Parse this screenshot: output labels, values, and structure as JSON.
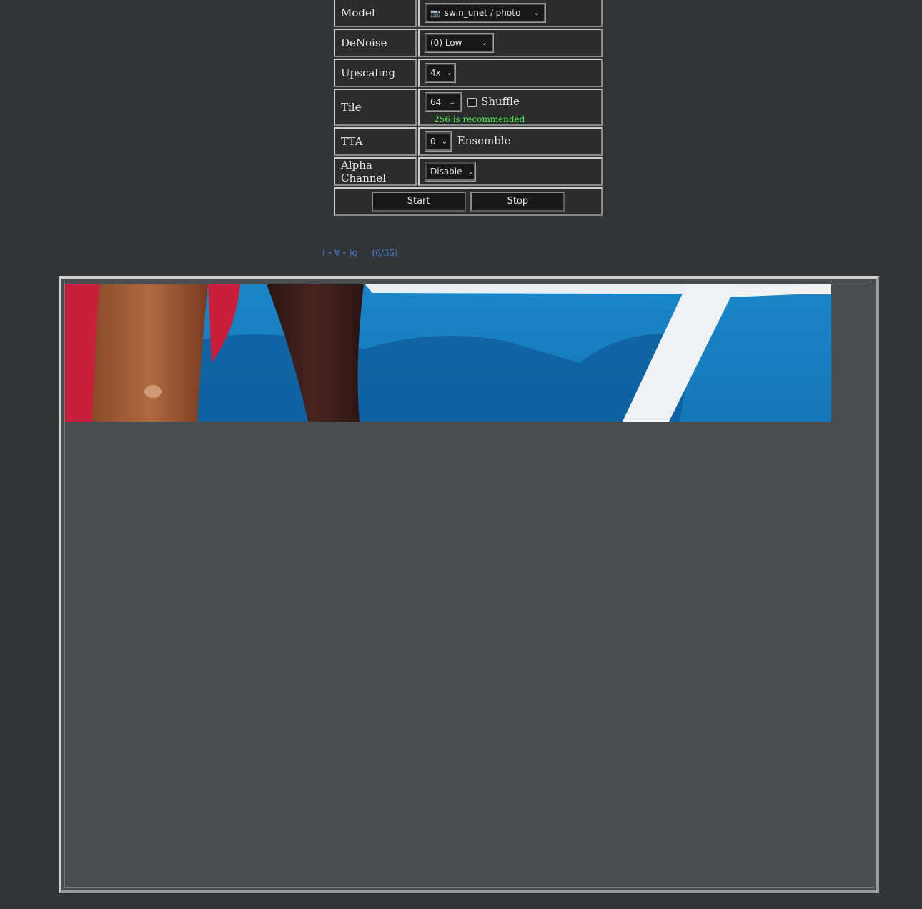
{
  "settings": {
    "model": {
      "label": "Model",
      "value": "swin_unet / photo",
      "icon": "camera-icon"
    },
    "denoise": {
      "label": "DeNoise",
      "value": "(0) Low"
    },
    "upscaling": {
      "label": "Upscaling",
      "value": "4x"
    },
    "tile": {
      "label": "Tile",
      "value": "64",
      "shuffle_label": "Shuffle",
      "shuffle_checked": false,
      "hint": "256 is recommended",
      "hint_color": "#47ef47"
    },
    "tta": {
      "label": "TTA",
      "value": "0",
      "ensemble_label": "Ensemble"
    },
    "alpha": {
      "label": "Alpha Channel",
      "value": "Disable"
    },
    "buttons": {
      "start": "Start",
      "stop": "Stop"
    }
  },
  "status": {
    "face": "(・∀・)φ",
    "progress": "(6/35)",
    "color": "#4a7fe0"
  },
  "viewer": {
    "image_description_icon": "processed-image-preview"
  }
}
